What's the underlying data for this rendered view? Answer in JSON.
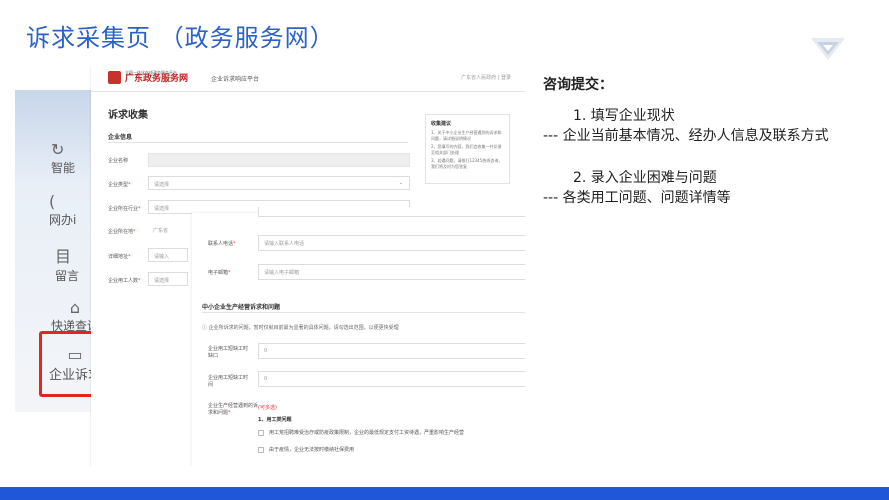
{
  "slide": {
    "title": "诉求采集页 （政务服务网）"
  },
  "colors": {
    "title": "#2a62c7",
    "bottom_bar": "#1f57d8",
    "highlight": "#e4261f"
  },
  "site": {
    "brand_small": "全国一体化在线政务服务平台",
    "brand_name": "广东政务服务网",
    "platform": "企业诉求响应平台",
    "top_links": "广东省人民政府 | 登录"
  },
  "sidebar": {
    "items": [
      {
        "icon": "↻",
        "label": "智能"
      },
      {
        "icon": "(",
        "label": "网办i"
      },
      {
        "icon": "目",
        "label": "留言"
      },
      {
        "icon": "⌂",
        "label": "快递查询"
      },
      {
        "icon": "▭",
        "label": "企业诉求"
      }
    ]
  },
  "form": {
    "title": "诉求收集",
    "section": "企业信息",
    "fields": {
      "company_name": {
        "label": "企业名称"
      },
      "company_type": {
        "label": "企业类型",
        "required": "*",
        "value": "请选择"
      },
      "industry": {
        "label": "企业所在行业",
        "required": "*",
        "value": "请选择"
      },
      "location": {
        "label": "企业所在地",
        "required": "*",
        "value": "广东省"
      },
      "address": {
        "label": "详细地址",
        "required": "*",
        "value": "请输入"
      },
      "staff": {
        "label": "企业用工人数",
        "required": "*",
        "value": "请选择"
      }
    }
  },
  "tip": {
    "title": "收集建议",
    "lines": [
      "1、关于中小企业生产经营遇到的诉求和问题，请详细说明情况",
      "2、您填写的内容，我们会收集一并反馈至相关部门处理",
      "3、若遇问题，请拨打12345热线咨询，我们将及时为您答复"
    ]
  },
  "overlay": {
    "contact_phone": {
      "label": "联系人电话",
      "required": "*",
      "placeholder": "请输入联系人电话"
    },
    "email": {
      "label": "电子邮箱",
      "required": "*",
      "placeholder": "请输入电子邮箱"
    },
    "section": "中小企业生产经营诉求和问题",
    "note": "ⓘ 企业所诉求的问题，暂时仅就目前最为显著的具体问题，请勾选出范围，以便更快受理",
    "gap_label": "企业用工短缺工时缺口",
    "gap_value": "0",
    "shortage_label": "企业用工短缺工时间",
    "shortage_value": "0",
    "problems_label": "企业生产经营遇到的诉求和问题",
    "problems_required": "*",
    "multi_select": "(可多选)",
    "category": "1、用工类问题",
    "options": [
      "用工荒招聘难受治疗或防疫政策限制，企业的最低规定支付工资待遇，严重影响生产经营",
      "由于疫情，企业无法按时缴纳社保费用"
    ]
  },
  "notes": {
    "heading": "咨询提交：",
    "steps": [
      {
        "title": "1.  填写企业现状",
        "desc": "--- 企业当前基本情况、经办人信息及联系方式"
      },
      {
        "title": "2.  录入企业困难与问题",
        "desc": "--- 各类用工问题、问题详情等"
      }
    ]
  }
}
